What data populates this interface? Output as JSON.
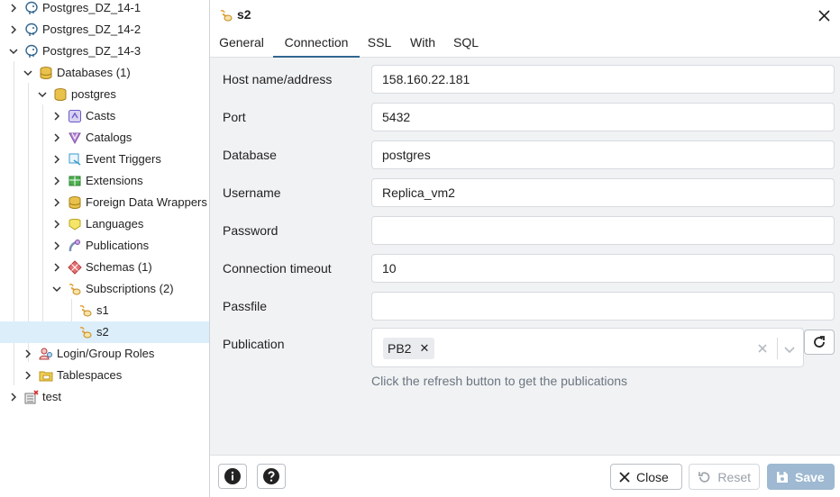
{
  "tree": {
    "nodes": [
      {
        "label": "Postgres_DZ_14-1",
        "icon": "elephant-server-icon",
        "expanded": false
      },
      {
        "label": "Postgres_DZ_14-2",
        "icon": "elephant-server-icon",
        "expanded": false
      },
      {
        "label": "Postgres_DZ_14-3",
        "icon": "elephant-server-icon",
        "expanded": true
      },
      {
        "label": "Databases",
        "count": "(1)",
        "icon": "databases-icon",
        "expanded": true
      },
      {
        "label": "postgres",
        "icon": "database-icon",
        "expanded": true
      },
      {
        "label": "Casts",
        "icon": "casts-icon",
        "expanded": false
      },
      {
        "label": "Catalogs",
        "icon": "catalogs-icon",
        "expanded": false
      },
      {
        "label": "Event Triggers",
        "icon": "event-triggers-icon",
        "expanded": false
      },
      {
        "label": "Extensions",
        "icon": "extensions-icon",
        "expanded": false
      },
      {
        "label": "Foreign Data Wrappers",
        "icon": "foreign-data-wrappers-icon",
        "expanded": false
      },
      {
        "label": "Languages",
        "icon": "languages-icon",
        "expanded": false
      },
      {
        "label": "Publications",
        "icon": "publications-icon",
        "expanded": false
      },
      {
        "label": "Schemas",
        "count": "(1)",
        "icon": "schemas-icon",
        "expanded": false
      },
      {
        "label": "Subscriptions",
        "count": "(2)",
        "icon": "subscriptions-icon",
        "expanded": true
      },
      {
        "label": "s1",
        "icon": "subscription-icon"
      },
      {
        "label": "s2",
        "icon": "subscription-icon",
        "selected": true
      },
      {
        "label": "Login/Group Roles",
        "icon": "roles-icon",
        "expanded": false
      },
      {
        "label": "Tablespaces",
        "icon": "tablespaces-icon",
        "expanded": false
      },
      {
        "label": "test",
        "icon": "server-disconnected-icon",
        "expanded": false
      }
    ]
  },
  "dialog": {
    "title": "s2",
    "title_icon": "subscription-icon",
    "tabs": [
      {
        "label": "General",
        "active": false
      },
      {
        "label": "Connection",
        "active": true
      },
      {
        "label": "SSL",
        "active": false
      },
      {
        "label": "With",
        "active": false
      },
      {
        "label": "SQL",
        "active": false
      }
    ],
    "fields": {
      "host": {
        "label": "Host name/address",
        "value": "158.160.22.181"
      },
      "port": {
        "label": "Port",
        "value": "5432"
      },
      "database": {
        "label": "Database",
        "value": "postgres"
      },
      "username": {
        "label": "Username",
        "value": "Replica_vm2"
      },
      "password": {
        "label": "Password",
        "value": ""
      },
      "timeout": {
        "label": "Connection timeout",
        "value": "10"
      },
      "passfile": {
        "label": "Passfile",
        "value": ""
      },
      "publication": {
        "label": "Publication",
        "selected": [
          "PB2"
        ]
      }
    },
    "publication_help": "Click the refresh button to get the publications",
    "footer": {
      "close_label": "Close",
      "reset_label": "Reset",
      "save_label": "Save"
    }
  },
  "colors": {
    "accent": "#326690",
    "selected_row": "#dbeefa",
    "form_bg": "#f1f2f4",
    "save_disabled": "#9eb9d1"
  }
}
